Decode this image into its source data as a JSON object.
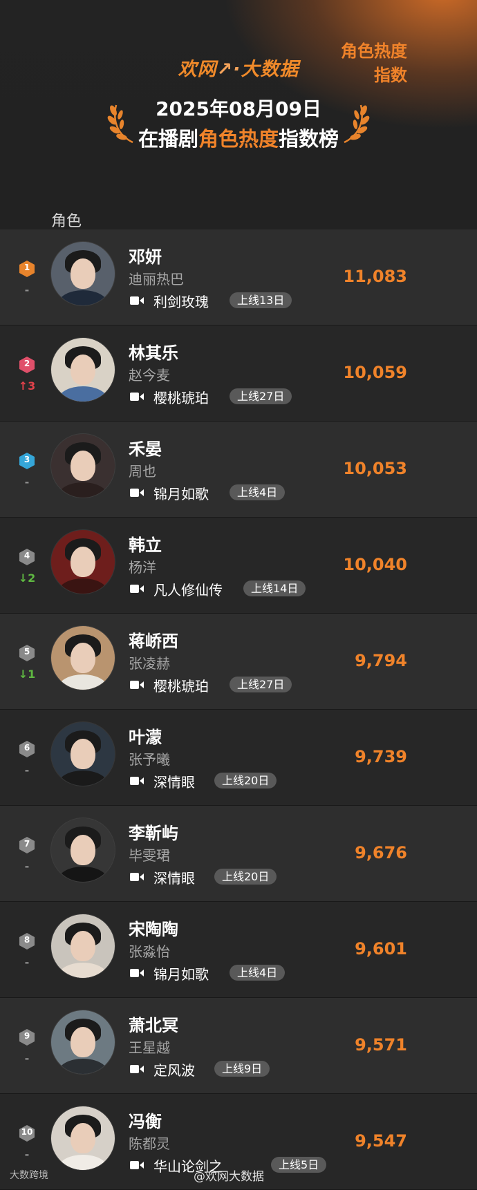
{
  "header": {
    "brand_part1": "欢网",
    "brand_mark": "↗·",
    "brand_part2": "大数据",
    "date": "2025年08月09日",
    "subtitle_prefix": "在播剧",
    "subtitle_highlight": "角色热度",
    "subtitle_suffix": "指数榜"
  },
  "columns": {
    "role": "角色",
    "score": "角色热度指数"
  },
  "colors": {
    "accent": "#f0832a",
    "rank1": "#e8842c",
    "rank2": "#e0506a",
    "rank3": "#35a6d8",
    "rank_other": "#8a8a8a",
    "up": "#e2424b",
    "down": "#5fb842"
  },
  "rows": [
    {
      "rank": "1",
      "change": "-",
      "change_dir": "none",
      "role": "邓妍",
      "actor": "迪丽热巴",
      "drama": "利剑玫瑰",
      "tag": "上线13日",
      "score": "11,083",
      "avatar_bg": "#58606b",
      "body": "#1f2a3a"
    },
    {
      "rank": "2",
      "change": "↑3",
      "change_dir": "up",
      "role": "林其乐",
      "actor": "赵今麦",
      "drama": "樱桃琥珀",
      "tag": "上线27日",
      "score": "10,059",
      "avatar_bg": "#d9d2c6",
      "body": "#4a6ea0"
    },
    {
      "rank": "3",
      "change": "-",
      "change_dir": "none",
      "role": "禾晏",
      "actor": "周也",
      "drama": "锦月如歌",
      "tag": "上线4日",
      "score": "10,053",
      "avatar_bg": "#3a3030",
      "body": "#2a1f1e"
    },
    {
      "rank": "4",
      "change": "↓2",
      "change_dir": "down",
      "role": "韩立",
      "actor": "杨洋",
      "drama": "凡人修仙传",
      "tag": "上线14日",
      "score": "10,040",
      "avatar_bg": "#6e1e1c",
      "body": "#3a1412"
    },
    {
      "rank": "5",
      "change": "↓1",
      "change_dir": "down",
      "role": "蒋峤西",
      "actor": "张凌赫",
      "drama": "樱桃琥珀",
      "tag": "上线27日",
      "score": "9,794",
      "avatar_bg": "#b9946f",
      "body": "#e9e6df"
    },
    {
      "rank": "6",
      "change": "-",
      "change_dir": "none",
      "role": "叶濛",
      "actor": "张予曦",
      "drama": "深情眼",
      "tag": "上线20日",
      "score": "9,739",
      "avatar_bg": "#2d3742",
      "body": "#1a1a1a"
    },
    {
      "rank": "7",
      "change": "-",
      "change_dir": "none",
      "role": "李靳屿",
      "actor": "毕雯珺",
      "drama": "深情眼",
      "tag": "上线20日",
      "score": "9,676",
      "avatar_bg": "#363636",
      "body": "#151515"
    },
    {
      "rank": "8",
      "change": "-",
      "change_dir": "none",
      "role": "宋陶陶",
      "actor": "张淼怡",
      "drama": "锦月如歌",
      "tag": "上线4日",
      "score": "9,601",
      "avatar_bg": "#c9c4bc",
      "body": "#e7dcd0"
    },
    {
      "rank": "9",
      "change": "-",
      "change_dir": "none",
      "role": "萧北冥",
      "actor": "王星越",
      "drama": "定风波",
      "tag": "上线9日",
      "score": "9,571",
      "avatar_bg": "#6d7a82",
      "body": "#2b2f33"
    },
    {
      "rank": "10",
      "change": "-",
      "change_dir": "none",
      "role": "冯衡",
      "actor": "陈都灵",
      "drama": "华山论剑之",
      "tag": "上线5日",
      "score": "9,547",
      "avatar_bg": "#d6d0c8",
      "body": "#f0ece6"
    }
  ],
  "footer": {
    "left_watermark": "大数跨境",
    "weibo": "@欢网大数据"
  }
}
